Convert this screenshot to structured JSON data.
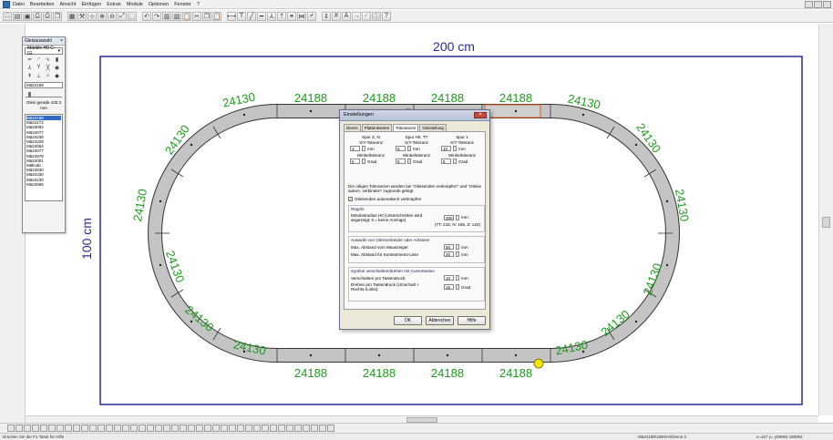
{
  "menu": [
    "Datei",
    "Bearbeiten",
    "Ansicht",
    "Einfügen",
    "Extras",
    "Module",
    "Optionen",
    "Fenster",
    "?"
  ],
  "toolbar_icons": [
    "new-icon",
    "open-icon",
    "save-icon",
    "print-preview-icon",
    "print-icon",
    "copy-icon",
    "grid-icon",
    "tool-icon",
    "snap-icon",
    "zoom-in-icon",
    "zoom-out-icon",
    "zoom-fit-icon",
    "zoom-window-icon",
    "undo-icon",
    "redo-icon",
    "layer-icon",
    "layer2-icon",
    "paste-icon",
    "cut-icon",
    "copy2-icon",
    "paste2-icon",
    "measure-icon",
    "text-icon",
    "line-icon",
    "track-icon",
    "switch-icon",
    "signal-icon",
    "connect-icon",
    "join-icon",
    "split-icon",
    "height-icon",
    "number-icon",
    "label-icon",
    "arrow-icon",
    "curve-icon",
    "info-icon",
    "help-icon"
  ],
  "layout": {
    "width_label": "200 cm",
    "height_label": "100 cm",
    "straight_top": [
      "24188",
      "24188",
      "24188",
      "24188"
    ],
    "straight_bottom": [
      "24188",
      "24188",
      "24188",
      "24188"
    ],
    "curve_labels": {
      "top_left": "24130",
      "top_right": "24130",
      "left_upper": "24130",
      "left_mid": "24130",
      "left_lower": "24130",
      "bottom_left_1": "24130",
      "bottom_left_2": "24130",
      "right_upper": "24130",
      "right_mid": "24130",
      "right_lower": "24130",
      "bottom_right_1": "24130",
      "bottom_right_2": "24130"
    },
    "colors": {
      "frame": "#2a2a9a",
      "label": "#1d9a1d",
      "track": "#c0c0c0",
      "track_edge": "#333333",
      "selected": "#e05a1e",
      "marker": "#f5e300"
    }
  },
  "panel": {
    "title": "Gleisauswahl",
    "combo": "Märklin H0 C-Gl.",
    "icons": [
      "straight-track-icon",
      "curve-track-icon",
      "flex-track-icon",
      "buffer-icon",
      "switch-left-icon",
      "switch-right-icon",
      "crossing-icon",
      "turntable-icon",
      "signal-icon",
      "decoupler-icon",
      "bridge-icon",
      "3d-icon"
    ],
    "name_field": "Mä24188",
    "description": "Gleis gerade 100.3 mm",
    "list": [
      "Mä24188",
      "Mä24172",
      "Mä24094",
      "Mä24077",
      "Mä24236",
      "Mä24229",
      "Mä24064",
      "Mä24077",
      "Mä24978",
      "Mä24001",
      "Mälinab",
      "Mä24530",
      "Mä24330",
      "Mä24230",
      "Mä24555"
    ]
  },
  "dialog": {
    "title": "Einstellungen",
    "tabs": [
      "Divers",
      "Plattenkanten",
      "Toleranzen",
      "Gleisteilung"
    ],
    "active_tab": "Toleranzen",
    "spur_cols": [
      {
        "name": "Spur Z, N",
        "xy_label": "X/Y-Toleranz",
        "xy": "3",
        "unit": "mm",
        "angle_label": "Winkeltoleranz",
        "angle": "5",
        "angle_unit": "Grad"
      },
      {
        "name": "Spur H0, TT",
        "xy_label": "X/Y-Toleranz",
        "xy": "5",
        "unit": "mm",
        "angle_label": "Winkeltoleranz",
        "angle": "5",
        "angle_unit": "Grad"
      },
      {
        "name": "Spur 1",
        "xy_label": "X/Y-Toleranz",
        "xy": "10",
        "unit": "mm",
        "angle_label": "Winkeltoleranz",
        "angle": "5",
        "angle_unit": "Grad"
      }
    ],
    "note": "Die obigen Toleranzen werden bei \"Gleisenden verknüpfen\" und \"Gleise autom. verbinden\" zugrunde gelegt.",
    "checkbox_label": "Gleisenden automatisch verknüpfen",
    "regeln": {
      "title": "Regeln",
      "row_label": "Mindestradius H0 (Unterschreiten wird angezeigt; 0 = keine Anzeige)",
      "value": "300",
      "unit": "mm",
      "hint": "(TT: 215, N: 165, Z: 120)"
    },
    "auswahl": {
      "title": "Auswahl von Gleisverbinder oder Anfasser",
      "rows": [
        {
          "label": "Max. Abstand vom Mauszeiger",
          "value": "60",
          "unit": "mm"
        },
        {
          "label": "Max. Abstand für Kontextmenü-Liste",
          "value": "20",
          "unit": "mm"
        }
      ]
    },
    "symbol": {
      "title": "Symbol verschieben/drehen mit Cursortasten",
      "rows": [
        {
          "label": "Verschieben pro Tastendruck:",
          "value": "10",
          "unit": "mm"
        },
        {
          "label": "Drehen pro Tastendruck (Umschalt + Rechts-/Links):",
          "value": "15",
          "unit": "Grad"
        }
      ]
    },
    "buttons": {
      "ok": "OK",
      "cancel": "Abbrechen",
      "help": "Hilfe"
    }
  },
  "status": {
    "left": "Drücken Sie die F1-Taste für Hilfe",
    "mid": "Mä24188/188mm/Ebene 0",
    "right": "x=167 y=   y09063 x09063"
  }
}
